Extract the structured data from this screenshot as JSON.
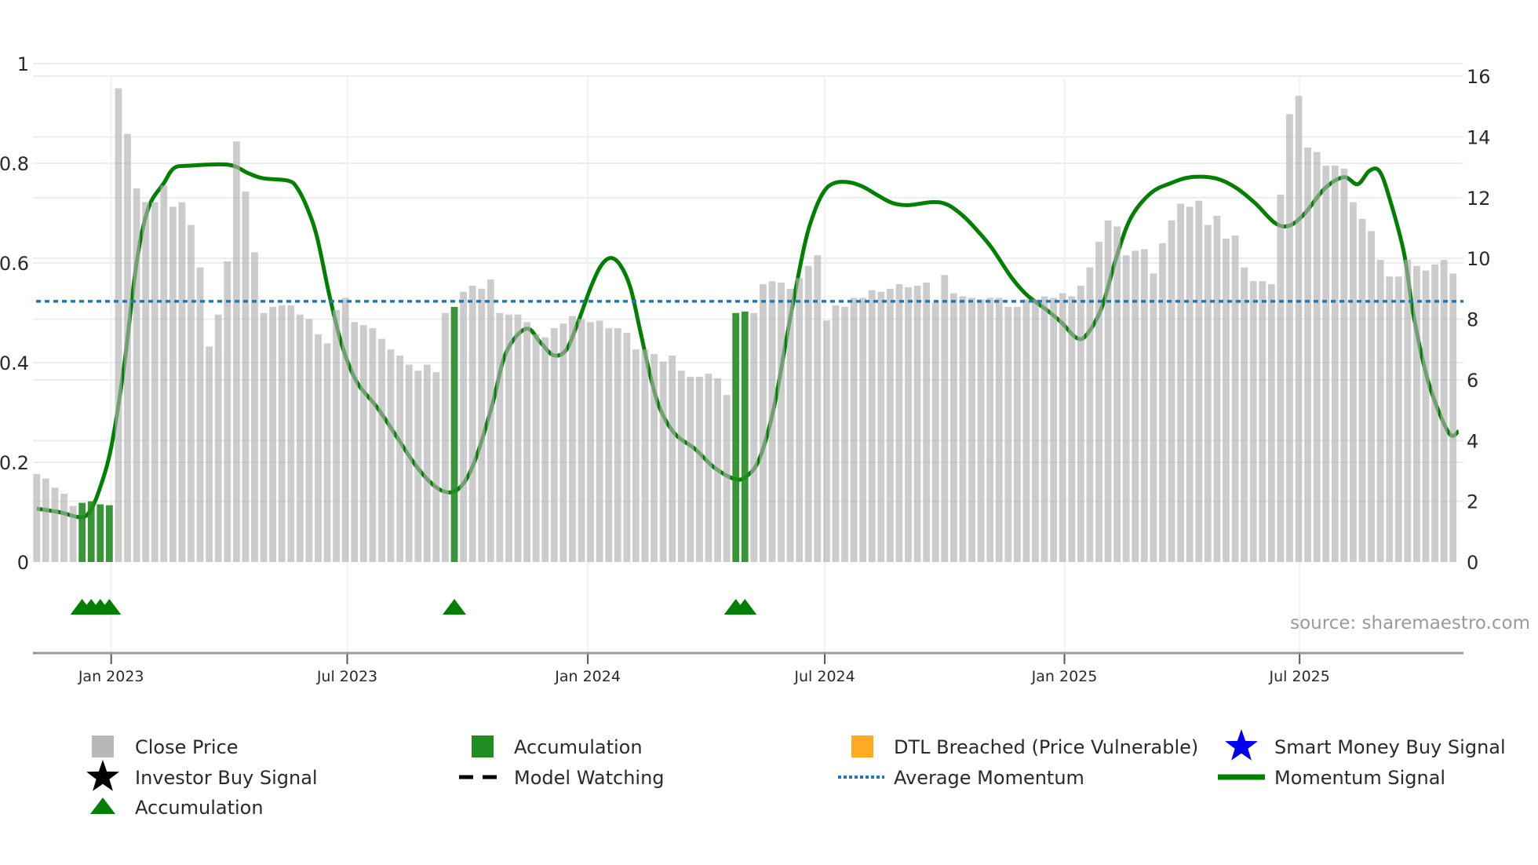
{
  "chart_data": {
    "type": "bar",
    "title": "",
    "source": "source: sharemaestro.com",
    "left_axis": {
      "ylim": [
        0,
        1
      ],
      "ticks": [
        0,
        0.2,
        0.4,
        0.6,
        0.8,
        1
      ],
      "tick_labels": [
        "0",
        "0.2",
        "0.4",
        "0.6",
        "0.8",
        "1"
      ]
    },
    "right_axis": {
      "ylim": [
        0,
        16
      ],
      "ticks": [
        0,
        2,
        4,
        6,
        8,
        10,
        12,
        14,
        16
      ],
      "tick_labels": [
        "0",
        "2",
        "4",
        "6",
        "8",
        "10",
        "12",
        "14",
        "16"
      ]
    },
    "x_ticks": [
      {
        "index": 8.2,
        "label": "Jan 2023"
      },
      {
        "index": 34.2,
        "label": "Jul 2023"
      },
      {
        "index": 60.7,
        "label": "Jan 2024"
      },
      {
        "index": 86.8,
        "label": "Jul 2024"
      },
      {
        "index": 113.2,
        "label": "Jan 2025"
      },
      {
        "index": 139.1,
        "label": "Jul 2025"
      }
    ],
    "close_price": [
      2.9,
      2.75,
      2.45,
      2.25,
      1.85,
      1.95,
      2.0,
      1.9,
      1.87,
      15.6,
      14.1,
      12.3,
      11.85,
      11.85,
      12.4,
      11.7,
      11.85,
      11.1,
      9.7,
      7.1,
      8.15,
      9.9,
      13.85,
      12.2,
      10.2,
      8.2,
      8.4,
      8.45,
      8.45,
      8.15,
      8.0,
      7.5,
      7.2,
      8.3,
      8.7,
      7.9,
      7.8,
      7.7,
      7.35,
      7.0,
      6.8,
      6.5,
      6.3,
      6.5,
      6.25,
      8.2,
      8.4,
      8.9,
      9.1,
      9.0,
      9.3,
      8.2,
      8.15,
      8.15,
      7.9,
      7.5,
      7.4,
      7.7,
      7.85,
      8.1,
      8.0,
      7.9,
      7.95,
      7.7,
      7.7,
      7.55,
      7.0,
      7.0,
      6.85,
      6.6,
      6.8,
      6.3,
      6.1,
      6.1,
      6.2,
      6.05,
      5.5,
      8.2,
      8.25,
      8.2,
      9.15,
      9.25,
      9.2,
      9.0,
      9.35,
      9.75,
      10.1,
      7.95,
      8.45,
      8.4,
      8.7,
      8.7,
      8.95,
      8.9,
      9.0,
      9.15,
      9.05,
      9.1,
      9.2,
      8.55,
      9.45,
      8.85,
      8.75,
      8.7,
      8.65,
      8.7,
      8.7,
      8.4,
      8.4,
      8.65,
      8.65,
      8.75,
      8.7,
      8.85,
      8.75,
      9.1,
      9.7,
      10.55,
      11.25,
      11.05,
      10.1,
      10.25,
      10.3,
      9.5,
      10.5,
      11.25,
      11.8,
      11.7,
      11.9,
      11.1,
      11.4,
      10.65,
      10.75,
      9.7,
      9.25,
      9.25,
      9.15,
      12.1,
      14.75,
      15.35,
      13.65,
      13.5,
      13.05,
      13.05,
      12.95,
      11.85,
      11.3,
      10.9,
      9.95,
      9.4,
      9.4,
      9.95,
      9.75,
      9.6,
      9.8,
      9.95,
      9.5
    ],
    "accumulation_bars": [
      5,
      6,
      7,
      8,
      46,
      77,
      78
    ],
    "accumulation_markers": [
      5,
      6,
      7,
      8,
      46,
      77,
      78
    ],
    "average_momentum": 0.523,
    "momentum_signal": [
      [
        0,
        0.107
      ],
      [
        2.5,
        0.1
      ],
      [
        4.7,
        0.09
      ],
      [
        5.8,
        0.1
      ],
      [
        6.9,
        0.145
      ],
      [
        8.2,
        0.23
      ],
      [
        9.6,
        0.39
      ],
      [
        11,
        0.6
      ],
      [
        12.3,
        0.71
      ],
      [
        14,
        0.76
      ],
      [
        15.1,
        0.79
      ],
      [
        16.7,
        0.795
      ],
      [
        21.1,
        0.797
      ],
      [
        23.3,
        0.78
      ],
      [
        24.9,
        0.77
      ],
      [
        27.7,
        0.765
      ],
      [
        28.7,
        0.75
      ],
      [
        29.8,
        0.71
      ],
      [
        30.9,
        0.65
      ],
      [
        32.3,
        0.53
      ],
      [
        33.7,
        0.43
      ],
      [
        35.3,
        0.36
      ],
      [
        37.5,
        0.31
      ],
      [
        39.7,
        0.25
      ],
      [
        41.9,
        0.19
      ],
      [
        44,
        0.15
      ],
      [
        45.7,
        0.14
      ],
      [
        47.1,
        0.16
      ],
      [
        48.4,
        0.21
      ],
      [
        50.1,
        0.31
      ],
      [
        51.7,
        0.42
      ],
      [
        53.9,
        0.468
      ],
      [
        55.5,
        0.44
      ],
      [
        56.9,
        0.415
      ],
      [
        58.3,
        0.425
      ],
      [
        59.6,
        0.48
      ],
      [
        61,
        0.55
      ],
      [
        62.1,
        0.593
      ],
      [
        63.2,
        0.61
      ],
      [
        64.3,
        0.595
      ],
      [
        65.4,
        0.55
      ],
      [
        66.4,
        0.47
      ],
      [
        67.5,
        0.38
      ],
      [
        68.6,
        0.31
      ],
      [
        70.3,
        0.257
      ],
      [
        72.5,
        0.227
      ],
      [
        74.6,
        0.19
      ],
      [
        76.8,
        0.167
      ],
      [
        78.1,
        0.171
      ],
      [
        79.6,
        0.207
      ],
      [
        81.2,
        0.31
      ],
      [
        82.8,
        0.47
      ],
      [
        84.5,
        0.63
      ],
      [
        85.6,
        0.7
      ],
      [
        86.7,
        0.743
      ],
      [
        87.8,
        0.76
      ],
      [
        89.4,
        0.762
      ],
      [
        91,
        0.753
      ],
      [
        92.7,
        0.735
      ],
      [
        94.3,
        0.72
      ],
      [
        96,
        0.716
      ],
      [
        98.7,
        0.722
      ],
      [
        100.3,
        0.717
      ],
      [
        102,
        0.695
      ],
      [
        103.6,
        0.665
      ],
      [
        105.2,
        0.63
      ],
      [
        107.4,
        0.57
      ],
      [
        109.1,
        0.535
      ],
      [
        111.3,
        0.505
      ],
      [
        112.9,
        0.48
      ],
      [
        114.5,
        0.45
      ],
      [
        115.6,
        0.455
      ],
      [
        117.3,
        0.51
      ],
      [
        118.9,
        0.61
      ],
      [
        120.5,
        0.69
      ],
      [
        122.7,
        0.74
      ],
      [
        124.9,
        0.76
      ],
      [
        127.1,
        0.772
      ],
      [
        129.8,
        0.77
      ],
      [
        132,
        0.752
      ],
      [
        134.2,
        0.72
      ],
      [
        136.4,
        0.68
      ],
      [
        138,
        0.675
      ],
      [
        139.7,
        0.7
      ],
      [
        141.9,
        0.75
      ],
      [
        144,
        0.772
      ],
      [
        145.5,
        0.758
      ],
      [
        146.8,
        0.785
      ],
      [
        147.9,
        0.784
      ],
      [
        149,
        0.73
      ],
      [
        150.6,
        0.62
      ],
      [
        151.7,
        0.49
      ],
      [
        153.3,
        0.36
      ],
      [
        155.5,
        0.26
      ],
      [
        156.6,
        0.262
      ]
    ],
    "colors": {
      "close_price": "#b0b0b0",
      "accumulation": "#228b22",
      "dtl": "#ffaa22",
      "smart_money": "#0000ee",
      "investor": "#000000",
      "avg_momentum": "#1f77b4",
      "momentum": "#008000",
      "marker": "#008000"
    },
    "legend": [
      {
        "label": "Close Price",
        "symbol": "gray-square"
      },
      {
        "label": "Accumulation",
        "symbol": "green-square"
      },
      {
        "label": "DTL Breached (Price Vulnerable)",
        "symbol": "orange-square"
      },
      {
        "label": "Smart Money Buy Signal",
        "symbol": "blue-star"
      },
      {
        "label": "Investor Buy Signal",
        "symbol": "black-star"
      },
      {
        "label": "Model Watching",
        "symbol": "black-dash"
      },
      {
        "label": "Average Momentum",
        "symbol": "blue-dot"
      },
      {
        "label": "Momentum Signal",
        "symbol": "green-line"
      },
      {
        "label": "Accumulation",
        "symbol": "green-triangle"
      }
    ]
  }
}
